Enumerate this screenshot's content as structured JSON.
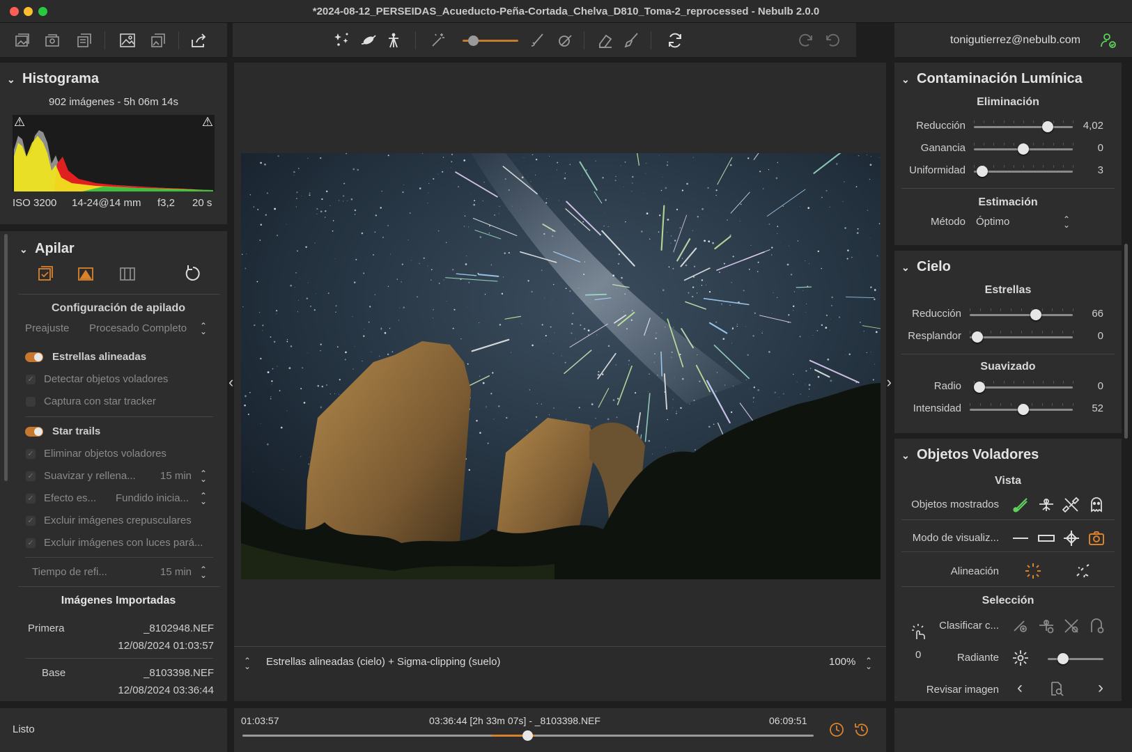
{
  "window": {
    "title": "*2024-08-12_PERSEIDAS_Acueducto-Peña-Cortada_Chelva_D810_Toma-2_reprocessed - Nebulb 2.0.0"
  },
  "account": {
    "email": "tonigutierrez@nebulb.com"
  },
  "histogram": {
    "title": "Histograma",
    "summary": "902 imágenes - 5h 06m 14s",
    "iso": "ISO 3200",
    "lens": "14-24@14 mm",
    "aperture": "f3,2",
    "exposure": "20 s"
  },
  "stack": {
    "title": "Apilar",
    "config_title": "Configuración de apilado",
    "preset_label": "Preajuste",
    "preset_value": "Procesado Completo",
    "aligned_stars": "Estrellas alineadas",
    "detect_flying": "Detectar objetos voladores",
    "star_tracker": "Captura con star tracker",
    "star_trails": "Star trails",
    "remove_flying": "Eliminar objetos voladores",
    "smooth_fill": "Suavizar y rellena...",
    "smooth_fill_value": "15 min",
    "effect": "Efecto es...",
    "effect_value": "Fundido inicia...",
    "exclude_twilight": "Excluir imágenes crepusculares",
    "exclude_lights": "Excluir imágenes con luces pará...",
    "refresh_label": "Tiempo de refi...",
    "refresh_value": "15 min",
    "imported_title": "Imágenes Importadas",
    "first_label": "Primera",
    "first_file": "_8102948.NEF",
    "first_date": "12/08/2024 01:03:57",
    "base_label": "Base",
    "base_file": "_8103398.NEF",
    "base_date": "12/08/2024 03:36:44"
  },
  "status": {
    "text": "Listo"
  },
  "viewer": {
    "mode": "Estrellas alineadas (cielo) + Sigma-clipping (suelo)",
    "zoom": "100%"
  },
  "timeline": {
    "start": "01:03:57",
    "current": "03:36:44 [2h 33m 07s] - _8103398.NEF",
    "end": "06:09:51",
    "position": 0.5
  },
  "light_pollution": {
    "title": "Contaminación Lumínica",
    "elimination": "Eliminación",
    "reduction_label": "Reducción",
    "reduction_value": "4,02",
    "reduction_pos": 0.78,
    "gain_label": "Ganancia",
    "gain_value": "0",
    "gain_pos": 0.5,
    "uniformity_label": "Uniformidad",
    "uniformity_value": "3",
    "uniformity_pos": 0.03,
    "estimation": "Estimación",
    "method_label": "Método",
    "method_value": "Óptimo"
  },
  "sky": {
    "title": "Cielo",
    "stars": "Estrellas",
    "reduction_label": "Reducción",
    "reduction_value": "66",
    "reduction_pos": 0.66,
    "glow_label": "Resplandor",
    "glow_value": "0",
    "glow_pos": 0.02,
    "smoothing": "Suavizado",
    "radius_label": "Radio",
    "radius_value": "0",
    "radius_pos": 0.0,
    "intensity_label": "Intensidad",
    "intensity_value": "52",
    "intensity_pos": 0.52
  },
  "flying": {
    "title": "Objetos Voladores",
    "view": "Vista",
    "shown_label": "Objetos mostrados",
    "mode_label": "Modo de visualiz...",
    "align_label": "Alineación",
    "selection": "Selección",
    "classify_label": "Clasificar c...",
    "count": "0",
    "radiant_label": "Radiante",
    "review_label": "Revisar imagen"
  },
  "colors": {
    "accent": "#d9822b",
    "green": "#5fd35a",
    "panel": "#2d2d2d"
  }
}
